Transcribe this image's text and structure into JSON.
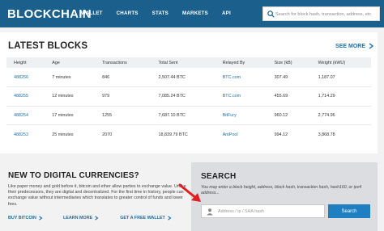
{
  "header": {
    "logo": "BLOCKCHAIN",
    "nav": [
      "WALLET",
      "CHARTS",
      "STATS",
      "MARKETS",
      "API"
    ],
    "search_placeholder": "Search for block hash, transaction, address, etc"
  },
  "latest_blocks": {
    "title": "LATEST BLOCKS",
    "see_more": "SEE MORE",
    "columns": [
      "Height",
      "Age",
      "Transactions",
      "Total Sent",
      "Relayed By",
      "Size (kB)",
      "Weight (kWU)"
    ],
    "rows": [
      [
        "488256",
        "7 minutes",
        "846",
        "2,507.44 BTC",
        "BTC.com",
        "307.49",
        "1,187.07"
      ],
      [
        "488255",
        "12 minutes",
        "979",
        "7,085.24 BTC",
        "BTC.com",
        "455.69",
        "1,714.29"
      ],
      [
        "488254",
        "17 minutes",
        "1255",
        "7,687.10 BTC",
        "BitFury",
        "960.12",
        "2,774.96"
      ],
      [
        "488253",
        "25 minutes",
        "2070",
        "18,839.79 BTC",
        "AntPool",
        "994.12",
        "3,868.78"
      ]
    ]
  },
  "promo": {
    "title": "NEW TO DIGITAL CURRENCIES?",
    "text": "Like paper money and gold before it, bitcoin and ether allow parties to exchange value. Unlike their predecessors, they are digital and decentralized. For the first time in history, people can exchange value without intermediaries which translates to greater control of funds and lower fees.",
    "links": [
      "BUY BITCOIN",
      "LEARN MORE",
      "GET A FREE WALLET"
    ]
  },
  "search": {
    "title": "SEARCH",
    "help": "You may enter a block height, address, block hash, transaction hash, hash160, or ipv4 address...",
    "placeholder": "Address / ip / SHA hash",
    "button": "Search"
  },
  "colors": {
    "brand": "#1b5f8c",
    "link": "#1b6fa8",
    "button": "#1f7fc1",
    "annotation_arrow": "#e02020"
  },
  "icons": [
    "search-icon",
    "chevron-right-icon",
    "user-icon",
    "red-arrow-annotation"
  ]
}
